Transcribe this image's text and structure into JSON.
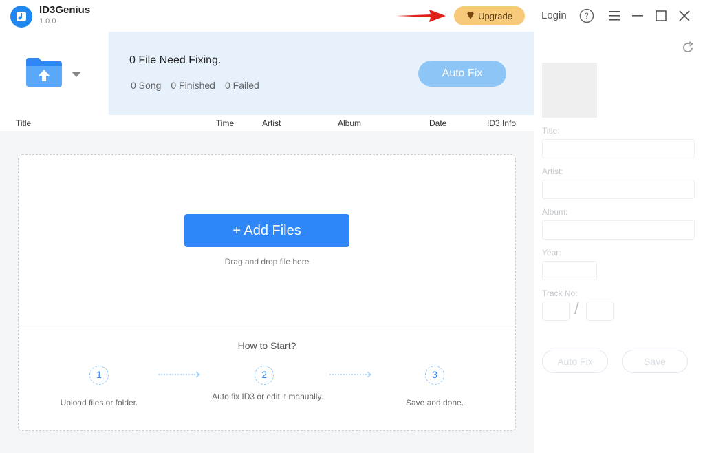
{
  "app": {
    "name": "ID3Genius",
    "version": "1.0.0"
  },
  "titlebar": {
    "upgrade_label": "Upgrade",
    "login_label": "Login",
    "icons": [
      "help-icon",
      "menu-icon",
      "minimize-icon",
      "maximize-icon",
      "close-icon"
    ]
  },
  "status": {
    "title": "0 File Need Fixing.",
    "song": "0 Song",
    "finished": "0 Finished",
    "failed": "0 Failed",
    "autofix_label": "Auto Fix"
  },
  "columns": [
    "Title",
    "Time",
    "Artist",
    "Album",
    "Date",
    "ID3 Info"
  ],
  "dropzone": {
    "add_files_label": "+ Add Files",
    "hint": "Drag and drop file here",
    "howto_title": "How to Start?",
    "steps": [
      {
        "num": "1",
        "text": "Upload files or folder."
      },
      {
        "num": "2",
        "text": "Auto fix ID3 or edit it manually."
      },
      {
        "num": "3",
        "text": "Save and done."
      }
    ]
  },
  "editor": {
    "title_label": "Title:",
    "artist_label": "Artist:",
    "album_label": "Album:",
    "year_label": "Year:",
    "track_label": "Track No:",
    "track_sep": "/",
    "autofix_label": "Auto Fix",
    "save_label": "Save"
  },
  "colors": {
    "accent": "#2f86f6",
    "upgrade": "#f7c97a",
    "status_bg": "#e7f1fc"
  }
}
